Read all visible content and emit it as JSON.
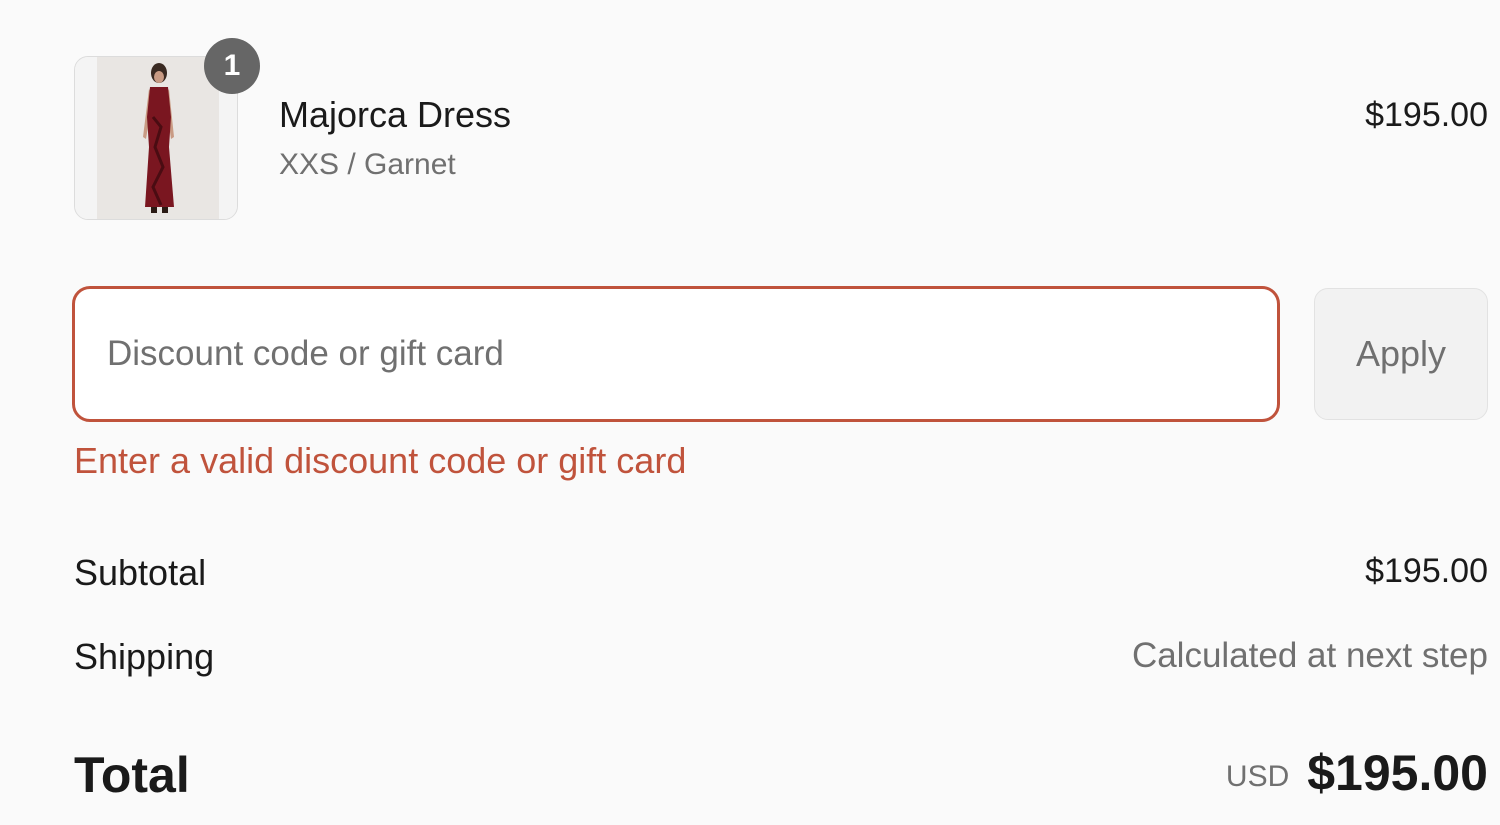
{
  "line_item": {
    "quantity": "1",
    "name": "Majorca Dress",
    "variant": "XXS / Garnet",
    "price": "$195.00"
  },
  "discount": {
    "placeholder": "Discount code or gift card",
    "value": "",
    "apply_label": "Apply",
    "error": "Enter a valid discount code or gift card"
  },
  "summary": {
    "subtotal_label": "Subtotal",
    "subtotal_value": "$195.00",
    "shipping_label": "Shipping",
    "shipping_value": "Calculated at next step",
    "total_label": "Total",
    "total_currency": "USD",
    "total_value": "$195.00"
  },
  "colors": {
    "error": "#c0533c",
    "muted": "#707070",
    "badge": "#666666"
  }
}
